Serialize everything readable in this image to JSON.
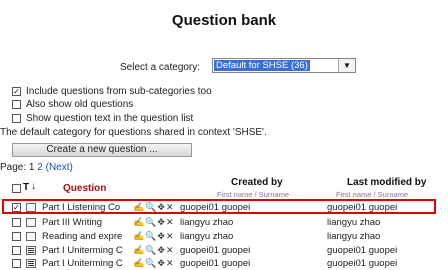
{
  "page_title": "Question bank",
  "category": {
    "label": "Select a category:",
    "selected": "Default for SHSE (36)"
  },
  "options": [
    {
      "label": "Include questions from sub-categories too",
      "checked": true
    },
    {
      "label": "Also show old questions",
      "checked": false
    },
    {
      "label": "Show question text in the question list",
      "checked": false
    }
  ],
  "context_note": "The default category for questions shared in context 'SHSE'.",
  "create_button": "Create a new question ...",
  "pagination": {
    "label": "Page:",
    "current": "1",
    "pages": [
      "2"
    ],
    "next": "(Next)"
  },
  "table": {
    "header_type": "T",
    "header_sort": "↓",
    "header_question": "Question",
    "header_created": "Created by",
    "header_created_sub": "First name / Surname",
    "header_modified": "Last modified by",
    "header_modified_sub": "First name / Surname",
    "row_actions": "✍🔍✥✕",
    "rows": [
      {
        "name": "Part I Listening Co",
        "created": "guopei01 guopei",
        "modified": "guopei01 guopei",
        "checked": true,
        "type": "box",
        "selected": true
      },
      {
        "name": "Part III Writing",
        "created": "liangyu zhao",
        "modified": "liangyu zhao",
        "checked": false,
        "type": "box",
        "selected": false
      },
      {
        "name": "Reading and expre",
        "created": "liangyu zhao",
        "modified": "liangyu zhao",
        "checked": false,
        "type": "box",
        "selected": false
      },
      {
        "name": "Part I Uniterming C",
        "created": "guopei01 guopei",
        "modified": "guopei01 guopei",
        "checked": false,
        "type": "list",
        "selected": false
      },
      {
        "name": "Part I Uniterming C",
        "created": "guopei01 guopei",
        "modified": "guopei01 guopei",
        "checked": false,
        "type": "list",
        "selected": false
      }
    ]
  },
  "colors": {
    "highlight": "#e00000",
    "select_bg": "#3a6fd8",
    "link": "#1a4fa8"
  }
}
